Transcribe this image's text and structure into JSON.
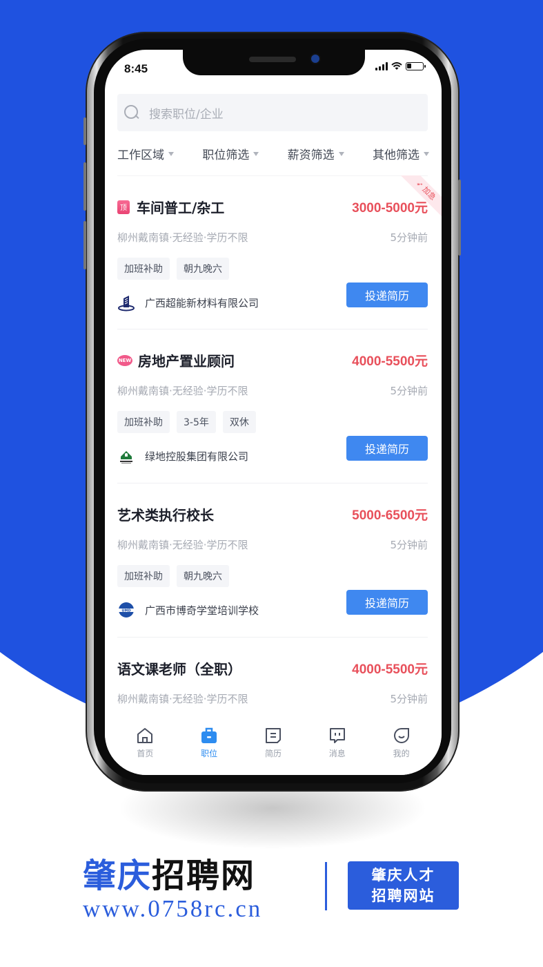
{
  "status_bar": {
    "time": "8:45"
  },
  "search": {
    "placeholder": "搜索职位/企业",
    "icon": "search-icon"
  },
  "filters": [
    {
      "label": "工作区域"
    },
    {
      "label": "职位筛选"
    },
    {
      "label": "薪资筛选"
    },
    {
      "label": "其他筛选"
    }
  ],
  "jobs": [
    {
      "badge": "顶",
      "badge_type": "top",
      "title": "车间普工/杂工",
      "salary": "3000-5000元",
      "meta": "柳州戴南镇·无经验·学历不限",
      "time": "5分钟前",
      "tags": [
        "加班补助",
        "朝九晚六"
      ],
      "company": "广西超能新材料有限公司",
      "apply_label": "投递简历",
      "urgent_label": "加急"
    },
    {
      "badge": "NEW",
      "badge_type": "new",
      "title": "房地产置业顾问",
      "salary": "4000-5500元",
      "meta": "柳州戴南镇·无经验·学历不限",
      "time": "5分钟前",
      "tags": [
        "加班补助",
        "3-5年",
        "双休"
      ],
      "company": "绿地控股集团有限公司",
      "apply_label": "投递简历"
    },
    {
      "title": "艺术类执行校长",
      "salary": "5000-6500元",
      "meta": "柳州戴南镇·无经验·学历不限",
      "time": "5分钟前",
      "tags": [
        "加班补助",
        "朝九晚六"
      ],
      "company": "广西市博奇学堂培训学校",
      "apply_label": "投递简历"
    },
    {
      "title": "语文课老师（全职）",
      "salary": "4000-5500元",
      "meta": "柳州戴南镇·无经验·学历不限",
      "time": "5分钟前"
    }
  ],
  "tabbar": [
    {
      "label": "首页",
      "icon": "home-icon",
      "active": false
    },
    {
      "label": "职位",
      "icon": "briefcase-icon",
      "active": true
    },
    {
      "label": "简历",
      "icon": "resume-icon",
      "active": false
    },
    {
      "label": "消息",
      "icon": "message-icon",
      "active": false
    },
    {
      "label": "我的",
      "icon": "profile-icon",
      "active": false
    }
  ],
  "brand": {
    "title_blue": "肇庆",
    "title_black": "招聘网",
    "url": "www.0758rc.cn",
    "badge_line1": "肇庆人才",
    "badge_line2": "招聘网站"
  },
  "colors": {
    "brand_blue": "#2b5ddc",
    "background_blue": "#1f52e0",
    "salary_red": "#e8505b",
    "apply_button": "#3f88f0",
    "active_tab": "#2d8cf0"
  }
}
